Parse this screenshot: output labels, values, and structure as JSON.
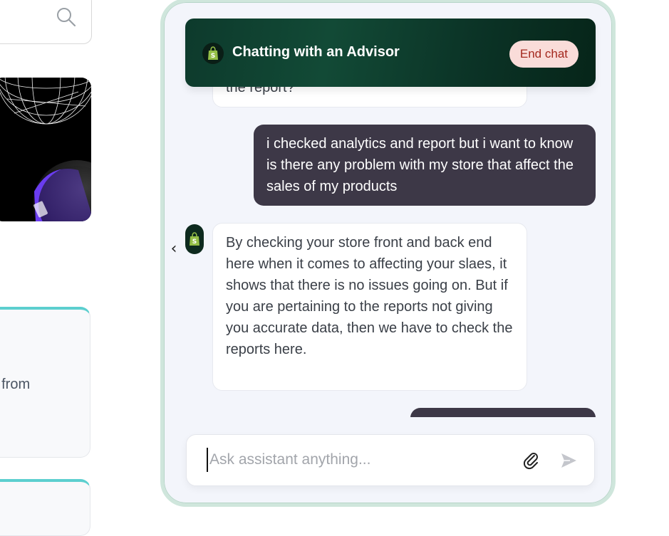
{
  "background_page": {
    "search_icon": "search-icon",
    "card_text": "fy from"
  },
  "chat": {
    "header": {
      "title": "Chatting with an Advisor",
      "end_chat_label": "End chat",
      "logo_icon": "shopify-bag-icon"
    },
    "messages": [
      {
        "sender": "advisor",
        "text": "the report?"
      },
      {
        "sender": "user",
        "text": "i checked analytics and report but i want to know is there any problem with my store that affect the sales of my products"
      },
      {
        "sender": "advisor",
        "text": "By checking your store front and back end here when it comes to affecting your slaes, it shows that there is no issues going on. But if you are pertaining to the reports not giving you accurate data, then we have to check the reports here."
      }
    ],
    "back_icon": "chevron-left-icon",
    "composer": {
      "placeholder": "Ask assistant anything...",
      "value": "",
      "attach_icon": "paperclip-icon",
      "send_icon": "send-icon"
    }
  },
  "colors": {
    "header_bg": "#0d3a2c",
    "user_bubble": "#3d3847",
    "end_chat_bg": "#f9dcd9",
    "end_chat_text": "#a4281e",
    "card_accent": "#5ccfcf"
  }
}
